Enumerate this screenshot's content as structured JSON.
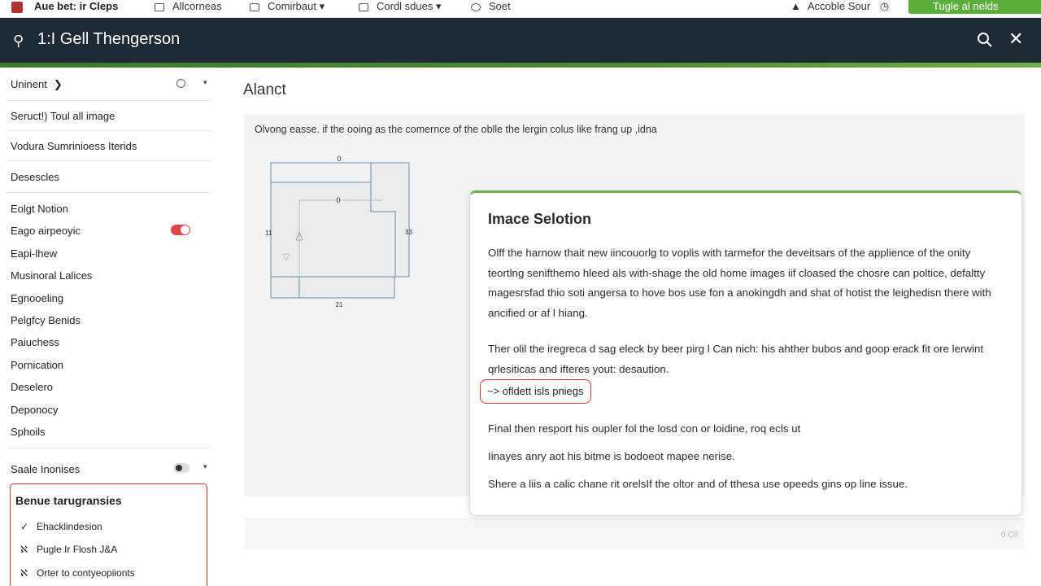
{
  "menubar": {
    "brand": "Aue bet: ir Cleps",
    "items": [
      {
        "label": "Allcorneas"
      },
      {
        "label": "Comirbaut"
      },
      {
        "label": "Cordl sdues"
      },
      {
        "label": "Soet"
      }
    ],
    "account_label": "Accoble Sour",
    "action_label": "Tugle al nelds"
  },
  "titlebar": {
    "title": "1:I Gell Thengerson"
  },
  "sidebar": {
    "top_item": "Uninent",
    "items": [
      "Seruct!) Toul all image",
      "Vodura Sumrinioess Iterids",
      "Desescles",
      "Eolgt Notion",
      "Eago airpeoyic",
      "Eapi-lhew",
      "Musinoral Lalices",
      "Egnooeling",
      "Pelgfcy Benids",
      "Paiuchess",
      "Pornication",
      "Deselero",
      "Deponocy",
      "Sphoils",
      "Saale Inonises"
    ],
    "box": {
      "title": "Benue tarugransies",
      "items": [
        {
          "label": "Ehacklindesion",
          "marker": "✓"
        },
        {
          "label": "Pugle Ir Flosh J&A",
          "marker": "ℵ"
        },
        {
          "label": "Orter to contyeopiionts",
          "marker": "ℵ"
        }
      ]
    }
  },
  "main": {
    "title": "Alanct",
    "description": "Olvong easse. if the ooing as the comernce of the oblle the lergin colus like frang up ,idna",
    "diagram_labels": {
      "top": "0",
      "inner": "0",
      "left": "11",
      "right": "33",
      "bottom": "21"
    },
    "footer_text": "0 CII"
  },
  "dialog": {
    "title": "Imace Selotion",
    "paragraph1": "Olff the harnow thait new iincouorlg to voplis with tarmefor the deveitsars of the applience of the onity teortlng senifthemo hleed als with-shage the old home images iif cloased the chosre can poltice, defaltty magesrsfad thio soti angersa to hove bos use fon a anokingdh and shat of hotist the leighedisn there with ancified or af l hiang.",
    "paragraph2": "Ther olil the iregreca d sag eleck by beer pirg l Can nich: his ahther bubos and goop erack fit ore lerwint qrlesiticas and ifteres yout: desaution.",
    "link": "~> ofldett isls pniegs",
    "line1": "Final then resport his oupler fol the losd con or loidine, roq ecls ut",
    "line2": "Iinayes anry aot his bitme is bodoeot mapee nerise.",
    "line3": "Shere a liis a calic chane rit orelsIf the oltor and of tthesa use opeeds gins op line issue."
  },
  "colors": {
    "titlebar_bg": "#1f2a37",
    "accent_green": "#5cae3c",
    "highlight_red": "#cc3a3a"
  }
}
